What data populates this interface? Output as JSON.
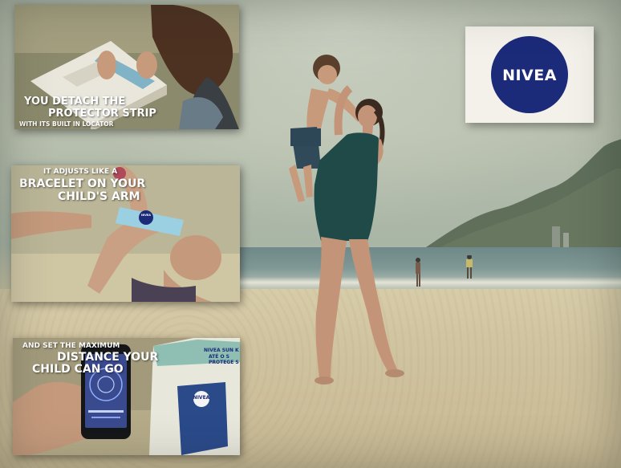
{
  "brand": {
    "name": "NIVEA",
    "circle_color": "#1c2a7a",
    "card_color": "#f3f1ea"
  },
  "panels": [
    {
      "id": "detach",
      "caption_lines": [
        "YOU DETACH THE",
        "PROTECTOR STRIP",
        "WITH ITS BUILT IN LOCATOR"
      ]
    },
    {
      "id": "bracelet",
      "caption_lines": [
        "IT ADJUSTS LIKE A",
        "BRACELET ON YOUR",
        "CHILD'S ARM"
      ],
      "band_brand": "NIVEA"
    },
    {
      "id": "distance",
      "caption_lines": [
        "AND SET THE MAXIMUM",
        "DISTANCE YOUR",
        "CHILD CAN GO"
      ],
      "magazine_brand": "NIVEA",
      "magazine_heading_lines": [
        "NIVEA SUN K",
        "ATÉ O S",
        "PROTEGE S"
      ]
    }
  ],
  "scene": {
    "setting": "beach",
    "colors": {
      "sky": "#b3bcab",
      "sea": "#768f8d",
      "sand": "#d2c6a1",
      "swimsuit": "#1f4a48"
    }
  }
}
